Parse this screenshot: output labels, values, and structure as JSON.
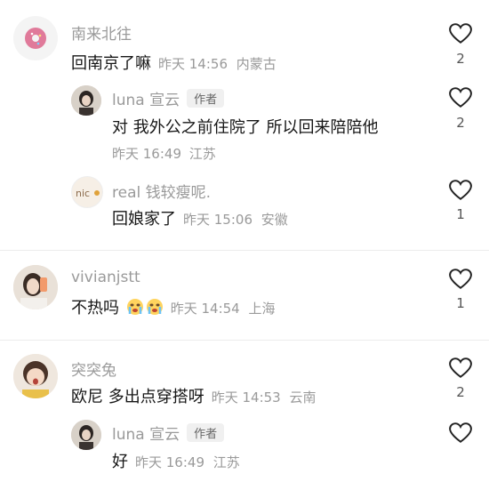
{
  "comments": [
    {
      "user": "南来北往",
      "text": "回南京了嘛",
      "time": "昨天 14:56",
      "location": "内蒙古",
      "likes": "2",
      "avatar_icon": "donut-avatar-icon"
    },
    {
      "user": "luna 宣云",
      "author_tag": "作者",
      "text": "对 我外公之前住院了 所以回来陪陪他",
      "time": "昨天 16:49",
      "location": "江苏",
      "likes": "2"
    },
    {
      "user": "real 钱较瘦呢.",
      "text": "回娘家了",
      "time": "昨天 15:06",
      "location": "安徽",
      "likes": "1"
    },
    {
      "user": "vivianjstt",
      "text": "不热吗",
      "emoji_icon": "crying-face-emoji",
      "time": "昨天 14:54",
      "location": "上海",
      "likes": "1"
    },
    {
      "user": "突突兔",
      "text": "欧尼 多出点穿搭呀",
      "time": "昨天 14:53",
      "location": "云南",
      "likes": "2"
    },
    {
      "user": "luna 宣云",
      "author_tag": "作者",
      "text": "好",
      "time": "昨天 16:49",
      "location": "江苏",
      "likes": ""
    }
  ],
  "avatar_text": {
    "nice": "nic"
  },
  "colors": {
    "meta": "#9a9a9a",
    "heart": "#222222"
  }
}
